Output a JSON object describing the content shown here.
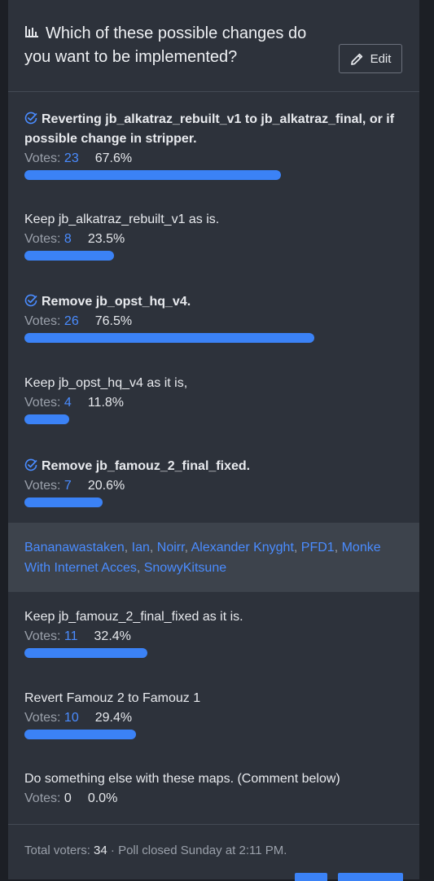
{
  "poll": {
    "question": "Which of these possible changes do you want to be implemented?",
    "edit_label": "Edit",
    "votes_label": "Votes:",
    "accent": "#3b82f6",
    "options": [
      {
        "label": "Reverting jb_alkatraz_rebuilt_v1 to jb_alkatraz_final, or if possible change in stripper.",
        "votes": "23",
        "percent": "67.6%",
        "fraction": 0.676,
        "selected": true
      },
      {
        "label": "Keep jb_alkatraz_rebuilt_v1 as is.",
        "votes": "8",
        "percent": "23.5%",
        "fraction": 0.235,
        "selected": false
      },
      {
        "label": "Remove jb_opst_hq_v4.",
        "votes": "26",
        "percent": "76.5%",
        "fraction": 0.765,
        "selected": true
      },
      {
        "label": "Keep jb_opst_hq_v4 as it is,",
        "votes": "4",
        "percent": "11.8%",
        "fraction": 0.118,
        "selected": false
      },
      {
        "label": "Remove jb_famouz_2_final_fixed.",
        "votes": "7",
        "percent": "20.6%",
        "fraction": 0.206,
        "selected": true
      },
      {
        "label": "Keep jb_famouz_2_final_fixed as it is.",
        "votes": "11",
        "percent": "32.4%",
        "fraction": 0.324,
        "selected": false
      },
      {
        "label": "Revert Famouz 2 to Famouz 1",
        "votes": "10",
        "percent": "29.4%",
        "fraction": 0.294,
        "selected": false
      },
      {
        "label": "Do something else with these maps. (Comment below)",
        "votes": "0",
        "percent": "0.0%",
        "fraction": 0.0,
        "selected": false
      }
    ],
    "voters": [
      "Bananawastaken",
      "Ian",
      "Noirr",
      "Alexander Knyght",
      "PFD1",
      "Monke With Internet Acces",
      "SnowyKitsune"
    ],
    "footer": {
      "total_label": "Total voters:",
      "total": "34",
      "closed_text": "· Poll closed Sunday at 2:11 PM."
    }
  }
}
